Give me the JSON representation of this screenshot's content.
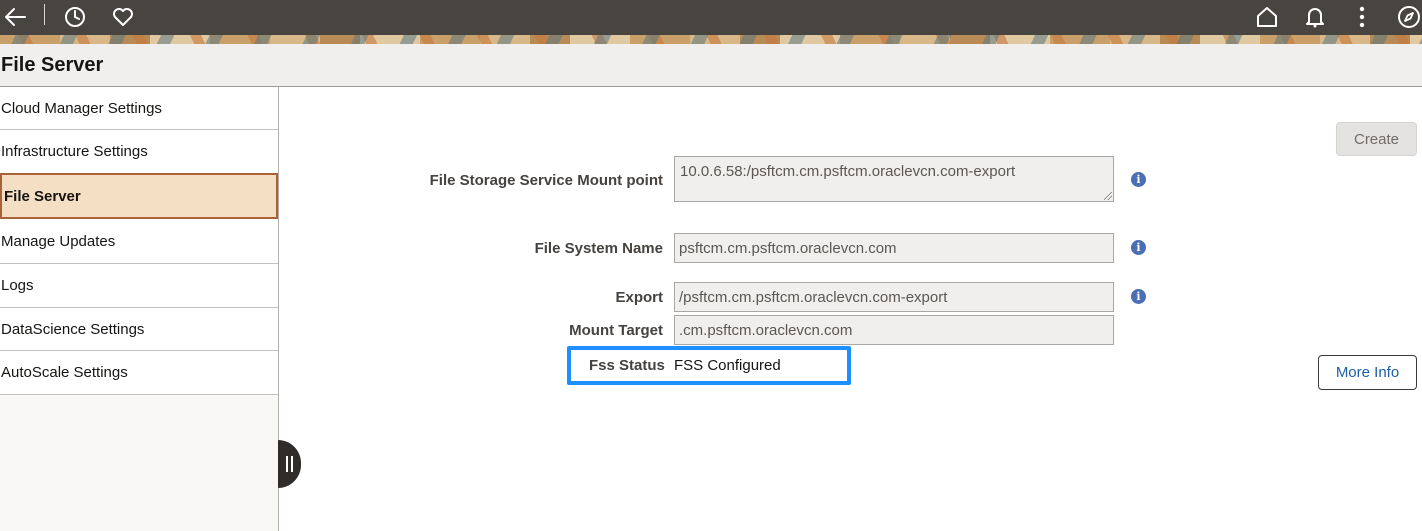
{
  "header": {
    "icons": [
      "back-arrow-icon",
      "history-icon",
      "favorites-icon",
      "home-icon",
      "notifications-icon",
      "more-actions-icon",
      "navigator-icon"
    ]
  },
  "page": {
    "title": "File Server"
  },
  "sidebar": {
    "items": [
      {
        "label": "Cloud Manager Settings"
      },
      {
        "label": "Infrastructure Settings"
      },
      {
        "label": "File Server",
        "selected": true
      },
      {
        "label": "Manage Updates"
      },
      {
        "label": "Logs"
      },
      {
        "label": "DataScience Settings"
      },
      {
        "label": "AutoScale Settings"
      }
    ]
  },
  "form": {
    "create_label": "Create",
    "mount_point": {
      "label": "File Storage Service Mount point",
      "value": "10.0.6.58:/psftcm.cm.psftcm.oraclevcn.com-export"
    },
    "file_system_name": {
      "label": "File System Name",
      "value": "psftcm.cm.psftcm.oraclevcn.com"
    },
    "export": {
      "label": "Export",
      "value": "/psftcm.cm.psftcm.oraclevcn.com-export"
    },
    "mount_target": {
      "label": "Mount Target",
      "value": ".cm.psftcm.oraclevcn.com"
    },
    "fss_status": {
      "label": "Fss Status",
      "value": "FSS Configured"
    },
    "more_info_label": "More Info",
    "info_glyph": "i"
  },
  "colors": {
    "highlight_border": "#1e8fff",
    "selected_nav_bg": "#f5dfc4",
    "selected_nav_border": "#a8623a",
    "link_blue": "#1c5fa8",
    "banner": "#484440"
  }
}
